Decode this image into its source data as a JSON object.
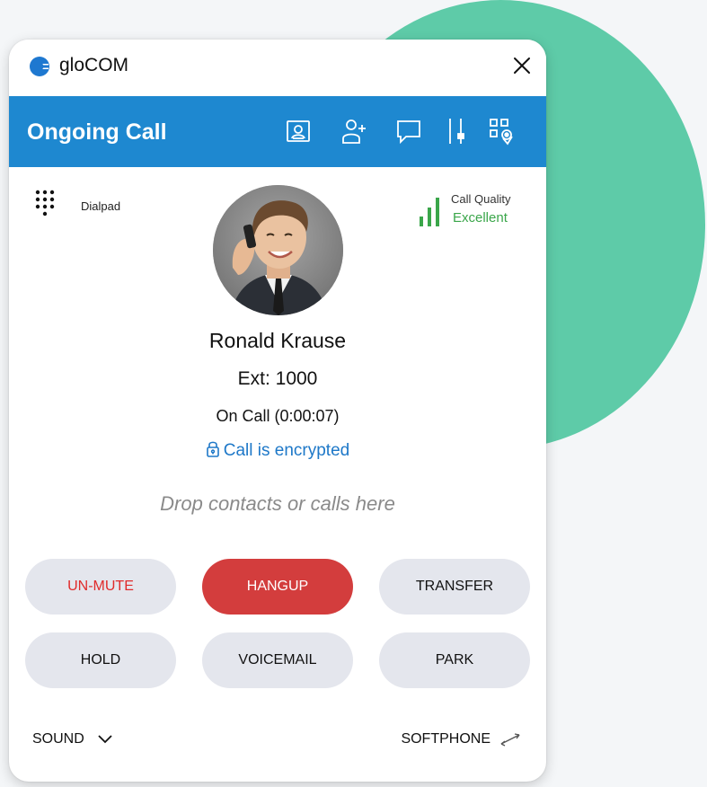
{
  "window": {
    "app_title": "gloCOM",
    "header_title": "Ongoing Call",
    "header_icons": [
      "contact-card-icon",
      "add-person-icon",
      "chat-icon",
      "call-control-icon",
      "qr-location-icon"
    ]
  },
  "call": {
    "dialpad_label": "Dialpad",
    "quality_label": "Call Quality",
    "quality_value": "Excellent",
    "caller_name": "Ronald Krause",
    "extension": "Ext: 1000",
    "status": "On Call (0:00:07)",
    "encryption": "Call is encrypted",
    "drop_hint": "Drop contacts or calls here"
  },
  "buttons": {
    "unmute": "UN-MUTE",
    "hangup": "HANGUP",
    "transfer": "TRANSFER",
    "hold": "HOLD",
    "voicemail": "VOICEMAIL",
    "park": "PARK"
  },
  "footer": {
    "sound": "SOUND",
    "softphone": "SOFTPHONE"
  },
  "colors": {
    "accent_blue": "#1e88d0",
    "hangup_red": "#d33d3d",
    "mute_text_red": "#e02b2b",
    "quality_green": "#3aa64a",
    "decor_circle": "#5ecba8"
  }
}
